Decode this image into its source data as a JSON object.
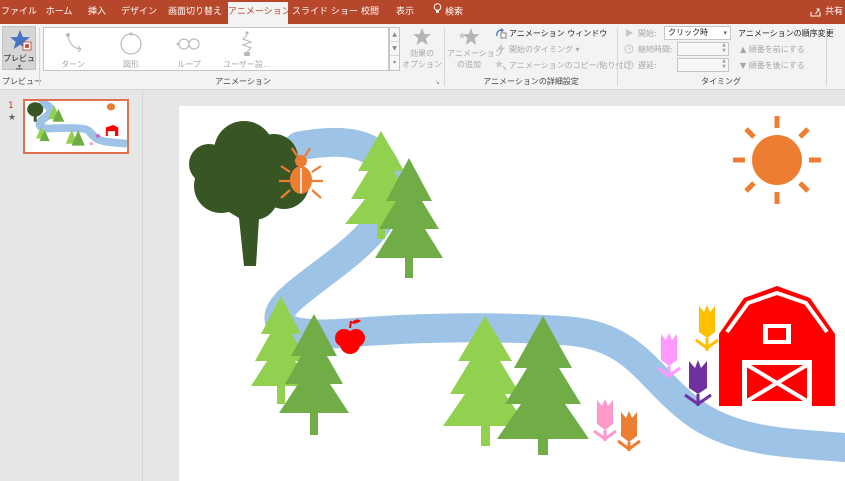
{
  "tabs": [
    {
      "label": "ファイル",
      "active": false
    },
    {
      "label": "ホーム",
      "active": false
    },
    {
      "label": "挿入",
      "active": false
    },
    {
      "label": "デザイン",
      "active": false
    },
    {
      "label": "画面切り替え",
      "active": false
    },
    {
      "label": "アニメーション",
      "active": true
    },
    {
      "label": "スライド ショー",
      "active": false
    },
    {
      "label": "校閲",
      "active": false
    },
    {
      "label": "表示",
      "active": false
    },
    {
      "label": "検索",
      "active": false
    }
  ],
  "share_label": "共有",
  "ribbon": {
    "preview": {
      "button": "プレビュー",
      "group": "プレビュー"
    },
    "animation": {
      "group": "アニメーション",
      "gallery": [
        {
          "label": "ターン",
          "icon": "turn-path-icon"
        },
        {
          "label": "図形",
          "icon": "shape-path-icon"
        },
        {
          "label": "ループ",
          "icon": "loop-path-icon"
        },
        {
          "label": "ユーザー設…",
          "icon": "custom-path-icon"
        }
      ],
      "effect_options": [
        "効果の",
        "オプション"
      ]
    },
    "advanced": {
      "group": "アニメーションの詳細設定",
      "add_animation": [
        "アニメーション",
        "の追加"
      ],
      "pane": "アニメーション ウィンドウ",
      "trigger": "開始のタイミング",
      "painter": "アニメーションのコピー/貼り付け"
    },
    "timing": {
      "group": "タイミング",
      "start_label": "開始:",
      "start_value": "クリック時",
      "duration_label": "継続時間:",
      "delay_label": "遅延:",
      "reorder_title": "アニメーションの順序変更",
      "move_earlier": "順番を前にする",
      "move_later": "順番を後にする"
    }
  },
  "thumbnails": [
    {
      "number": "1",
      "marker": "★"
    }
  ],
  "colors": {
    "accent": "#b7472a",
    "river": "#9dc3e6",
    "tree_light": "#92d050",
    "tree_mid": "#70ad47",
    "oak": "#375623",
    "sun": "#ed7d31",
    "barn": "#ff0000"
  }
}
